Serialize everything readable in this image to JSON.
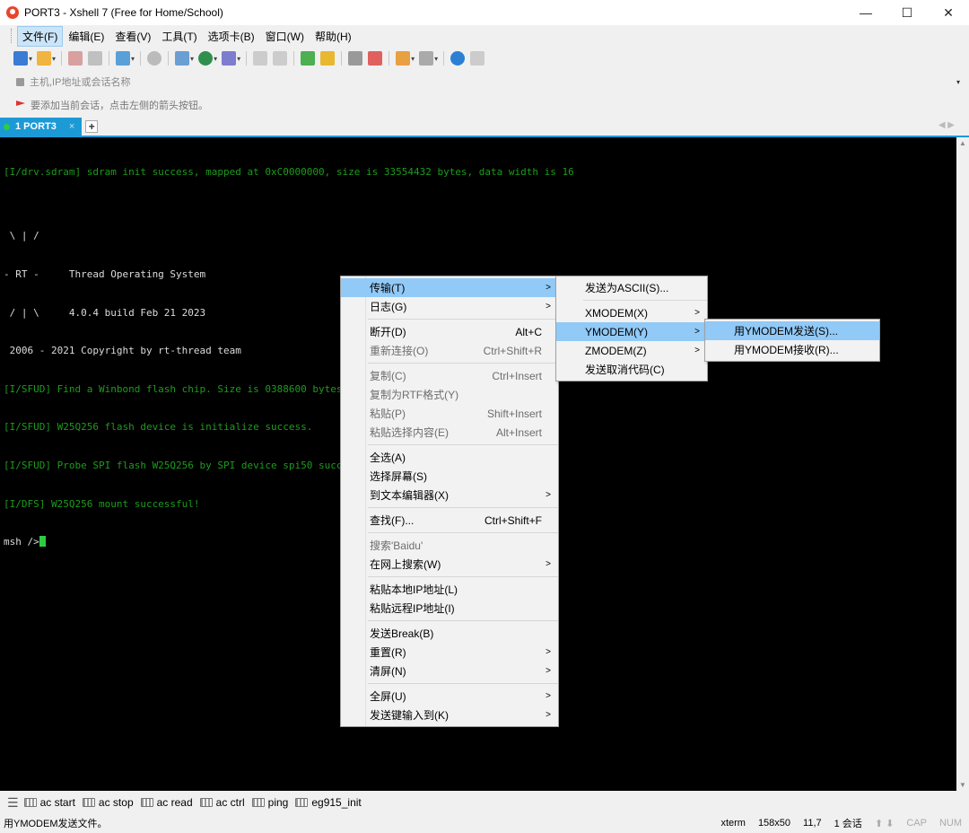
{
  "window": {
    "title": "PORT3 - Xshell 7 (Free for Home/School)",
    "minimize": "—",
    "maximize": "☐",
    "close": "✕"
  },
  "menubar": [
    "文件(F)",
    "编辑(E)",
    "查看(V)",
    "工具(T)",
    "选项卡(B)",
    "窗口(W)",
    "帮助(H)"
  ],
  "address": {
    "placeholder": "主机,IP地址或会话名称"
  },
  "hint": "要添加当前会话，点击左侧的箭头按钮。",
  "tab": {
    "label": "1 PORT3",
    "close": "×",
    "add": "+"
  },
  "terminal": {
    "lines": [
      {
        "text": "[I/drv.sdram] sdram init success, mapped at 0xC0000000, size is 33554432 bytes, data width is 16",
        "color": "green"
      },
      {
        "text": "",
        "color": "white"
      },
      {
        "text": " \\ | /",
        "color": "white"
      },
      {
        "text": "- RT -     Thread Operating System",
        "color": "white"
      },
      {
        "text": " / | \\     4.0.4 build Feb 21 2023",
        "color": "white"
      },
      {
        "text": " 2006 - 2021 Copyright by rt-thread team",
        "color": "white"
      },
      {
        "text": "[I/SFUD] Find a Winbond flash chip. Size is 0388600 bytes.",
        "color": "green"
      },
      {
        "text": "[I/SFUD] W25Q256 flash device is initialize success.",
        "color": "green"
      },
      {
        "text": "[I/SFUD] Probe SPI flash W25Q256 by SPI device spi50 success.",
        "color": "green"
      },
      {
        "text": "[I/DFS] W25Q256 mount successful!",
        "color": "green"
      }
    ],
    "prompt": "msh />"
  },
  "context_menu": {
    "items": [
      {
        "label": "传输(T)",
        "submenu": true,
        "highlight": true
      },
      {
        "label": "日志(G)",
        "submenu": true
      },
      {
        "sep": true
      },
      {
        "label": "断开(D)",
        "shortcut": "Alt+C"
      },
      {
        "label": "重新连接(O)",
        "shortcut": "Ctrl+Shift+R",
        "disabled": true
      },
      {
        "sep": true
      },
      {
        "label": "复制(C)",
        "shortcut": "Ctrl+Insert",
        "disabled": true
      },
      {
        "label": "复制为RTF格式(Y)",
        "disabled": true
      },
      {
        "label": "粘贴(P)",
        "shortcut": "Shift+Insert",
        "disabled": true
      },
      {
        "label": "粘贴选择内容(E)",
        "shortcut": "Alt+Insert",
        "disabled": true
      },
      {
        "sep": true
      },
      {
        "label": "全选(A)"
      },
      {
        "label": "选择屏幕(S)"
      },
      {
        "label": "到文本编辑器(X)",
        "submenu": true
      },
      {
        "sep": true
      },
      {
        "label": "查找(F)...",
        "shortcut": "Ctrl+Shift+F"
      },
      {
        "sep": true
      },
      {
        "label": "搜索'Baidu'",
        "disabled": true
      },
      {
        "label": "在网上搜索(W)",
        "submenu": true
      },
      {
        "sep": true
      },
      {
        "label": "粘贴本地IP地址(L)"
      },
      {
        "label": "粘贴远程IP地址(I)"
      },
      {
        "sep": true
      },
      {
        "label": "发送Break(B)"
      },
      {
        "label": "重置(R)",
        "submenu": true
      },
      {
        "label": "清屏(N)",
        "submenu": true
      },
      {
        "sep": true
      },
      {
        "label": "全屏(U)",
        "submenu": true
      },
      {
        "label": "发送键输入到(K)",
        "submenu": true
      }
    ]
  },
  "transfer_menu": {
    "items": [
      {
        "label": "发送为ASCII(S)..."
      },
      {
        "sep": true
      },
      {
        "label": "XMODEM(X)",
        "submenu": true
      },
      {
        "label": "YMODEM(Y)",
        "submenu": true,
        "highlight": true
      },
      {
        "label": "ZMODEM(Z)",
        "submenu": true
      },
      {
        "label": "发送取消代码(C)"
      }
    ]
  },
  "ymodem_menu": {
    "items": [
      {
        "label": "用YMODEM发送(S)...",
        "highlight": true
      },
      {
        "label": "用YMODEM接收(R)..."
      }
    ]
  },
  "quick_commands": [
    "ac start",
    "ac stop",
    "ac read",
    "ac ctrl",
    "ping",
    "eg915_init"
  ],
  "status": {
    "message": "用YMODEM发送文件。",
    "term": "xterm",
    "size": "158x50",
    "pos": "11,7",
    "sessions": "1 会话",
    "cap": "CAP",
    "num": "NUM"
  },
  "colors": {
    "accent": "#1c9ad6",
    "menu_highlight": "#91c9f7",
    "term_green": "#1c9c1c"
  }
}
